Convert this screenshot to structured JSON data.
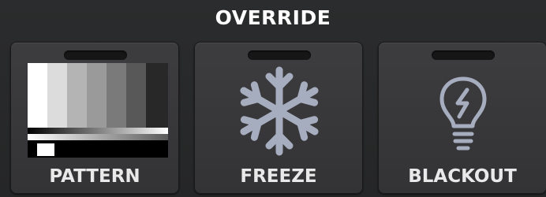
{
  "override": {
    "title": "OVERRIDE",
    "buttons": [
      {
        "label": "PATTERN",
        "icon": "test-pattern-icon"
      },
      {
        "label": "FREEZE",
        "icon": "snowflake-icon"
      },
      {
        "label": "BLACKOUT",
        "icon": "lightbulb-icon"
      }
    ]
  },
  "colors": {
    "background": "#2a2b2c",
    "button": "#39393b",
    "icon": "#a6adbf",
    "label": "#e9e9ea"
  }
}
